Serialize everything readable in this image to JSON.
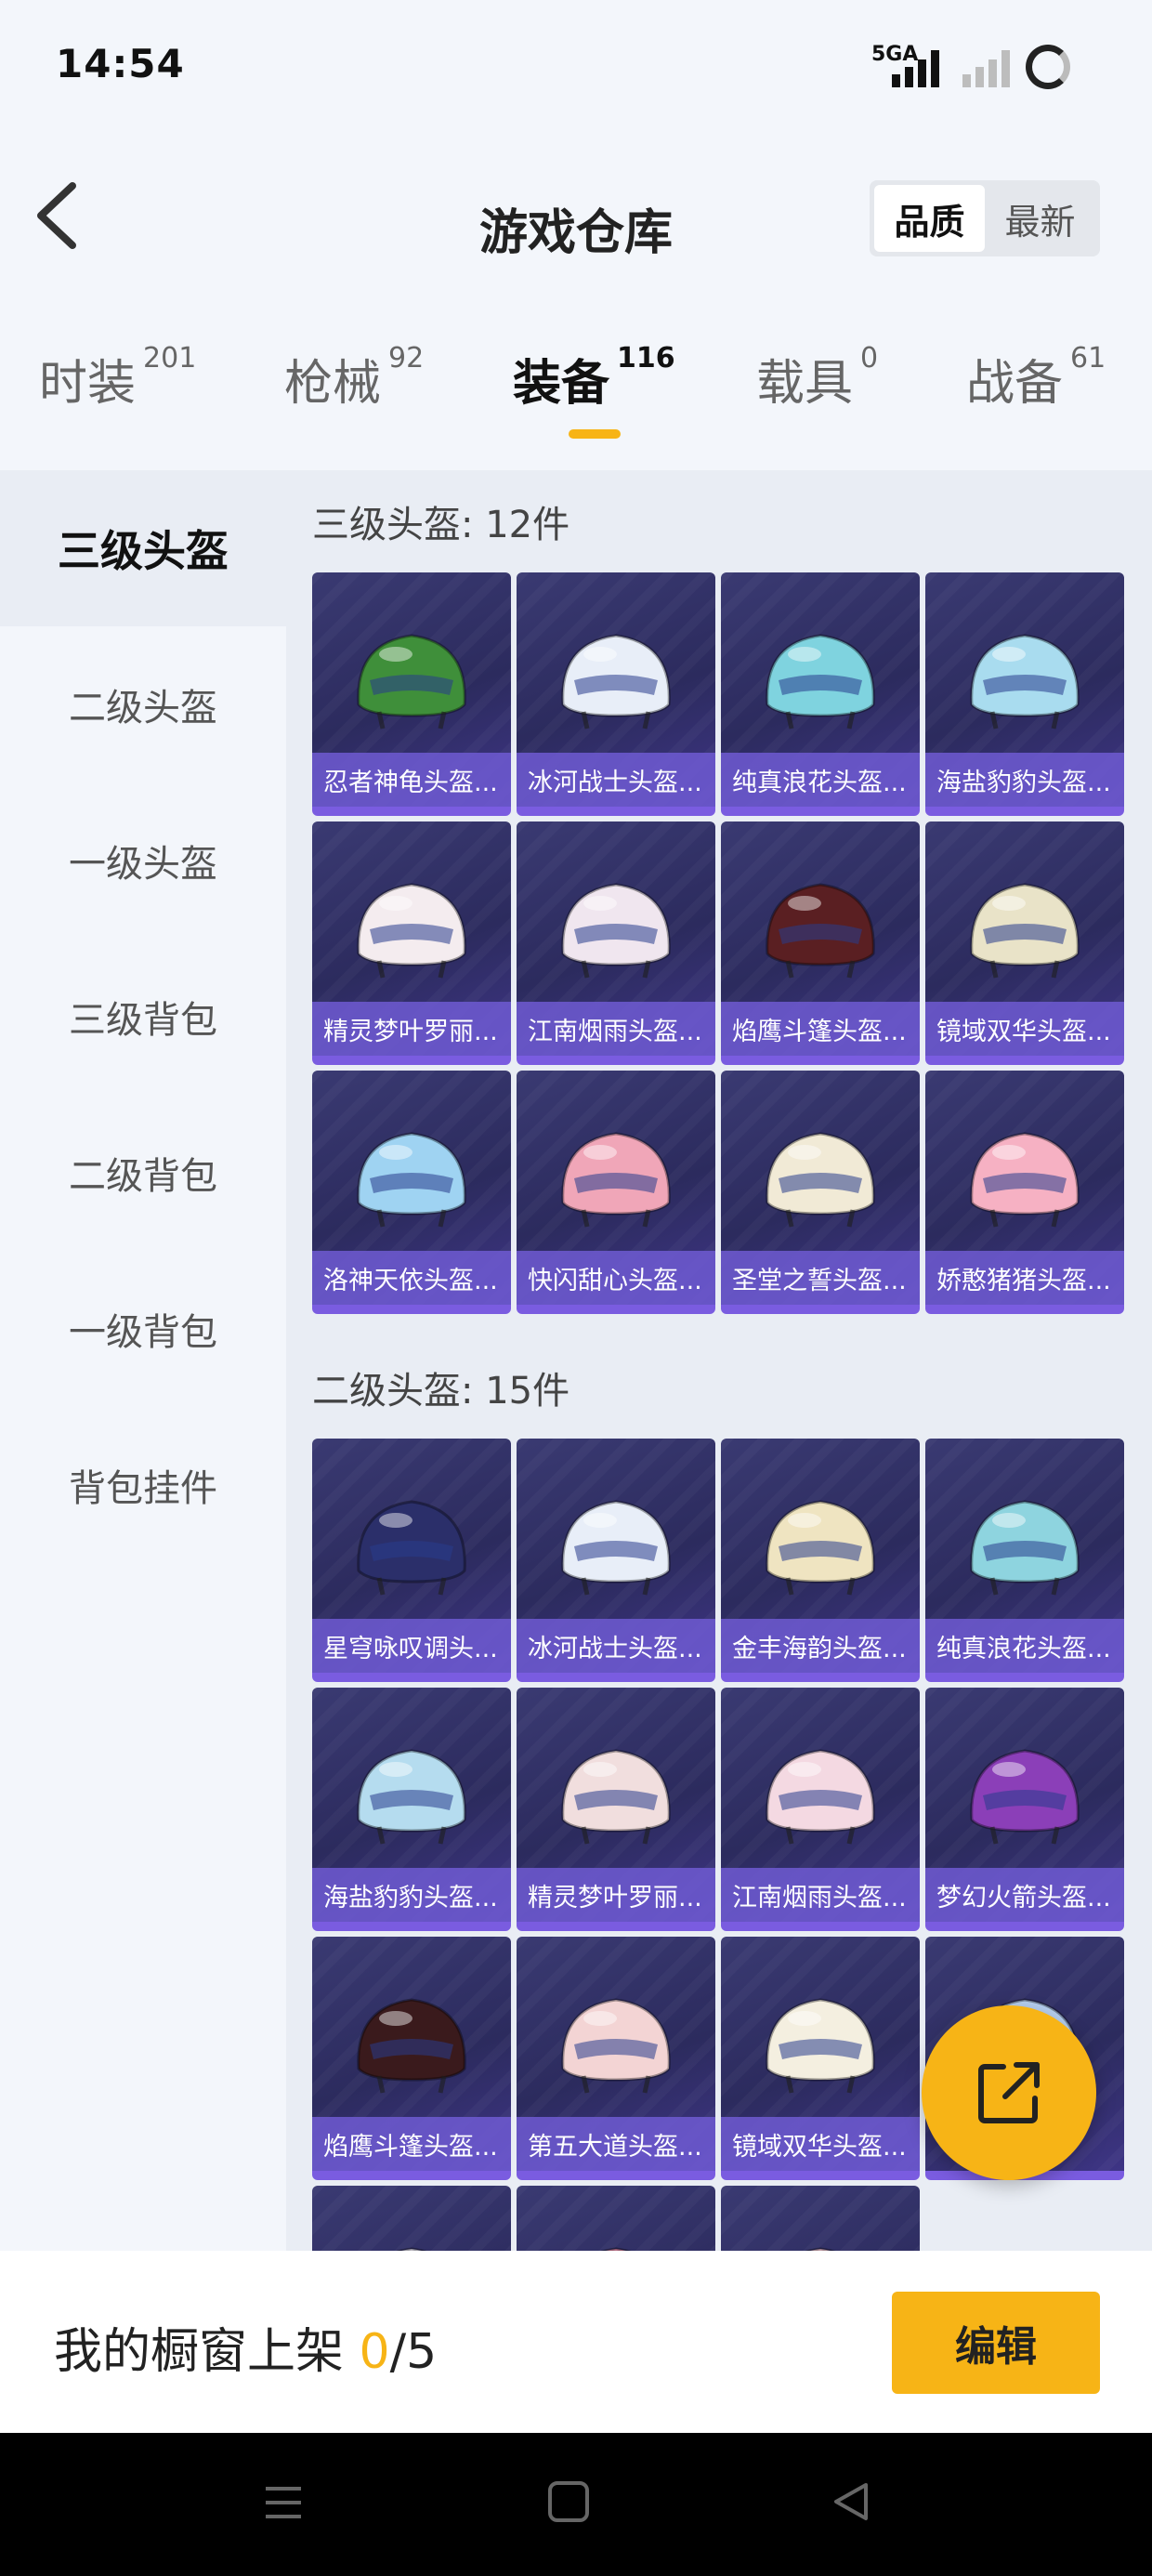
{
  "status_bar": {
    "time": "14:54",
    "network": "5GA"
  },
  "header": {
    "title": "游戏仓库",
    "sort_options": [
      "品质",
      "最新"
    ],
    "sort_selected": "品质"
  },
  "tabs": [
    {
      "label": "时装",
      "count": "201"
    },
    {
      "label": "枪械",
      "count": "92"
    },
    {
      "label": "装备",
      "count": "116"
    },
    {
      "label": "载具",
      "count": "0"
    },
    {
      "label": "战备",
      "count": "61"
    }
  ],
  "active_tab": "装备",
  "sidebar": {
    "items": [
      "三级头盔",
      "二级头盔",
      "一级头盔",
      "三级背包",
      "二级背包",
      "一级背包",
      "背包挂件"
    ],
    "active": "三级头盔"
  },
  "sections": [
    {
      "title": "三级头盔: 12件",
      "items": [
        {
          "name": "忍者神龟头盔...",
          "color": "#3f8f3a"
        },
        {
          "name": "冰河战士头盔...",
          "color": "#e8eef8"
        },
        {
          "name": "纯真浪花头盔...",
          "color": "#7fd3df"
        },
        {
          "name": "海盐豹豹头盔...",
          "color": "#a9dcef"
        },
        {
          "name": "精灵梦叶罗丽...",
          "color": "#f4ecef"
        },
        {
          "name": "江南烟雨头盔...",
          "color": "#f0e6ef"
        },
        {
          "name": "焰鹰斗篷头盔...",
          "color": "#5a1f22"
        },
        {
          "name": "镜域双华头盔...",
          "color": "#e9e3c8"
        },
        {
          "name": "洛神天依头盔...",
          "color": "#9fd3f2"
        },
        {
          "name": "快闪甜心头盔...",
          "color": "#f0a6b8"
        },
        {
          "name": "圣堂之誓头盔...",
          "color": "#f1ead6"
        },
        {
          "name": "娇憨猪猪头盔...",
          "color": "#f6b1c3"
        }
      ]
    },
    {
      "title": "二级头盔: 15件",
      "items": [
        {
          "name": "星穹咏叹调头...",
          "color": "#2b2f6a"
        },
        {
          "name": "冰河战士头盔...",
          "color": "#e8eef8"
        },
        {
          "name": "金丰海韵头盔...",
          "color": "#efe4c1"
        },
        {
          "name": "纯真浪花头盔...",
          "color": "#8ed4df"
        },
        {
          "name": "海盐豹豹头盔...",
          "color": "#b5dcef"
        },
        {
          "name": "精灵梦叶罗丽...",
          "color": "#f1dede"
        },
        {
          "name": "江南烟雨头盔...",
          "color": "#f4d9e2"
        },
        {
          "name": "梦幻火箭头盔...",
          "color": "#8b3fb8"
        },
        {
          "name": "焰鹰斗篷头盔...",
          "color": "#3a1a1c"
        },
        {
          "name": "第五大道头盔...",
          "color": "#f3d4d4"
        },
        {
          "name": "镜域双华头盔...",
          "color": "#f4efe0"
        },
        {
          "name": "",
          "color": "#b6cff0"
        },
        {
          "name": "",
          "color": "#ece8f4"
        },
        {
          "name": "",
          "color": "#e88aa8"
        },
        {
          "name": "",
          "color": "#f4c6d2"
        }
      ]
    }
  ],
  "showcase": {
    "prefix": "我的橱窗上架 ",
    "current": "0",
    "suffix": "/5"
  },
  "edit_label": "编辑",
  "colors": {
    "accent": "#f7b416",
    "card_bg": "#2c2b5e",
    "card_label": "#6e5ad2"
  }
}
